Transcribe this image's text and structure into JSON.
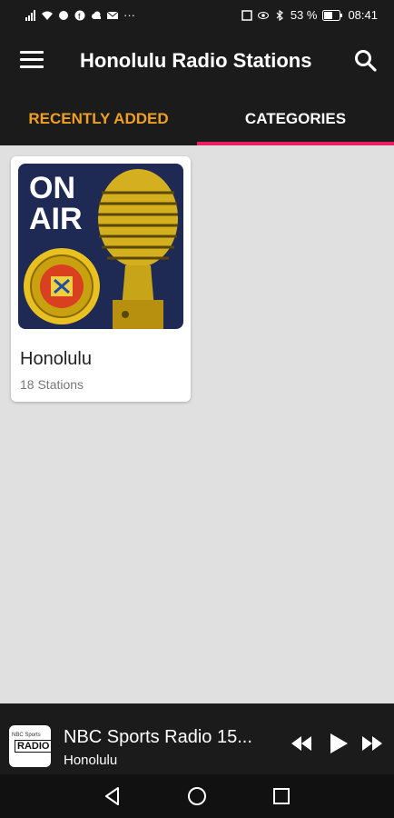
{
  "status_bar": {
    "battery_percent": "53 %",
    "time": "08:41",
    "left_icons": [
      "signal-icon",
      "wifi-icon",
      "app-icon",
      "facebook-icon",
      "cloud-icon",
      "mail-icon",
      "more-icon"
    ],
    "more_text": "···"
  },
  "app_bar": {
    "title": "Honolulu Radio Stations",
    "menu_icon": "menu-icon",
    "search_icon": "search-icon"
  },
  "tabs": [
    {
      "label": "RECENTLY ADDED",
      "selected": false
    },
    {
      "label": "CATEGORIES",
      "selected": true
    }
  ],
  "colors": {
    "accent": "#e91e63",
    "tab_recent": "#f0a020",
    "bar_bg": "#1b1b1b",
    "content_bg": "#e0e0e0"
  },
  "categories": [
    {
      "name": "Honolulu",
      "count": "18 Stations",
      "image": {
        "line1": "ON",
        "line2": "AIR"
      }
    }
  ],
  "player": {
    "title": "NBC Sports Radio 15...",
    "subtitle": "Honolulu",
    "thumb_text_small": "NBC Sports",
    "thumb_text_big": "RADIO"
  }
}
